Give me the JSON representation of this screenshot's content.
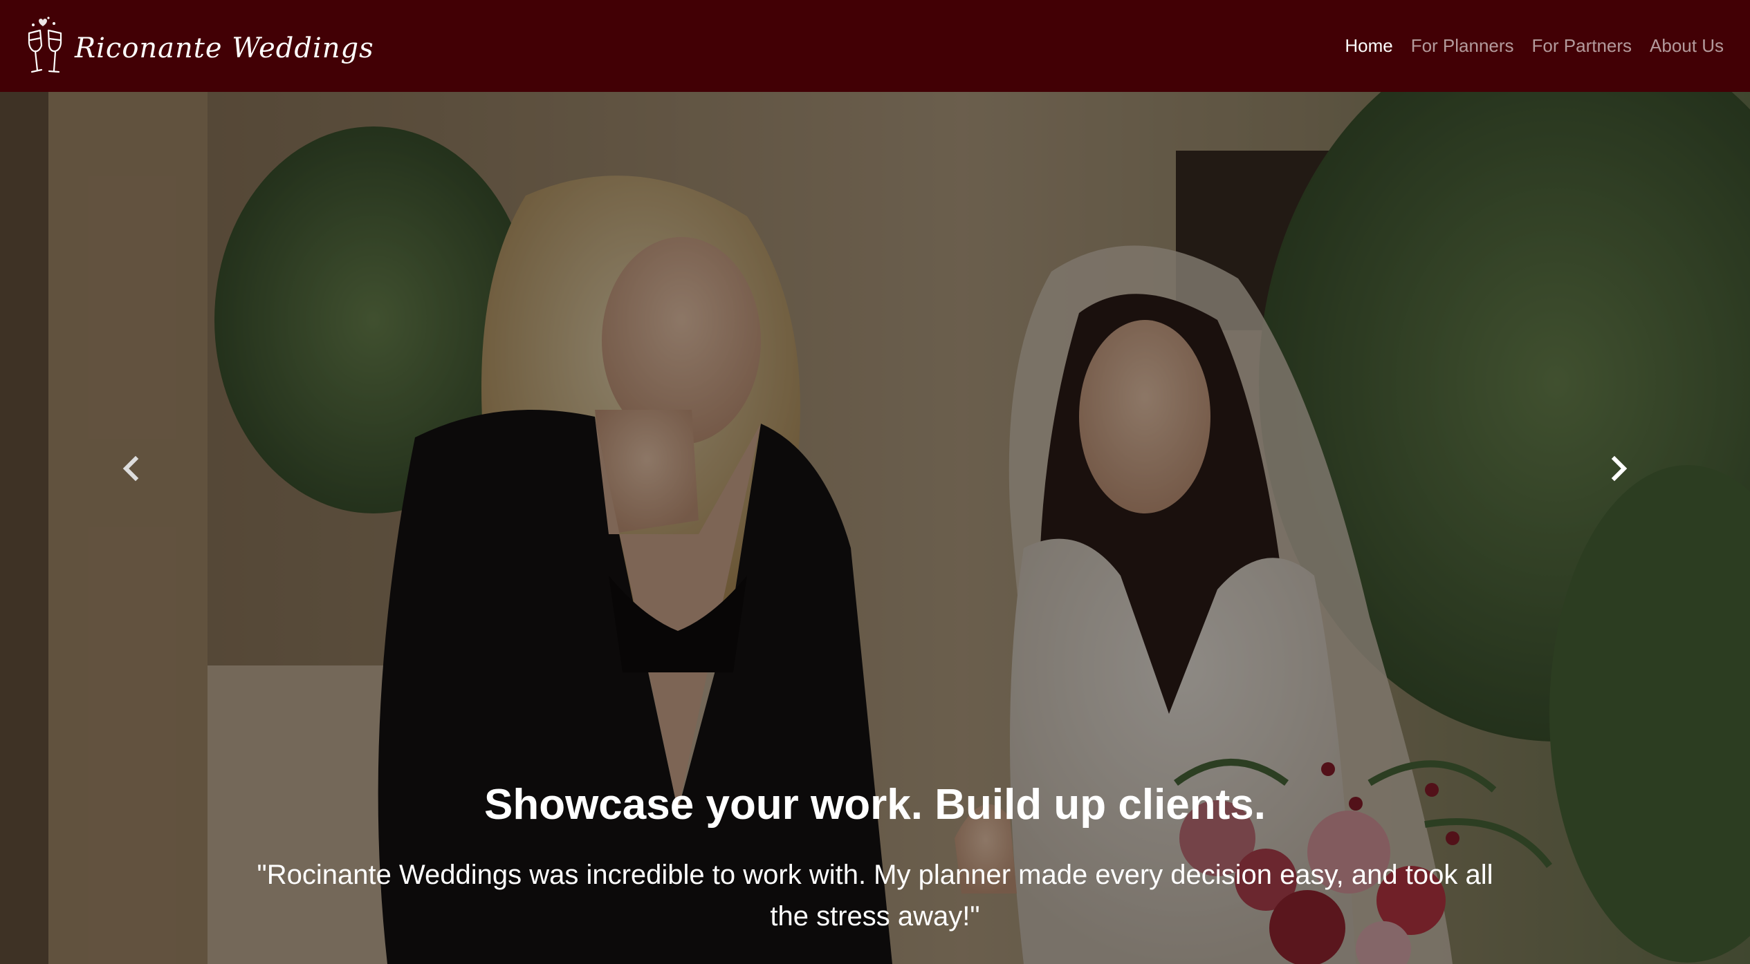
{
  "nav": {
    "brand": "Ricon ante Weddings",
    "brand_text": "Riconante Weddings",
    "links": [
      {
        "label": "Home",
        "active": true
      },
      {
        "label": "For Planners",
        "active": false
      },
      {
        "label": "For Partners",
        "active": false
      },
      {
        "label": "About Us",
        "active": false
      }
    ]
  },
  "hero": {
    "title": "Showcase your work. Build up clients.",
    "quote": "\"Rocinante Weddings was incredible to work with. My planner made every decision easy, and took all the stress away!\"",
    "prev_icon": "chevron-left-icon",
    "next_icon": "chevron-right-icon"
  },
  "colors": {
    "navbar_bg": "#420005",
    "nav_active": "#ffffff",
    "nav_inactive": "rgba(255,255,255,0.6)"
  }
}
